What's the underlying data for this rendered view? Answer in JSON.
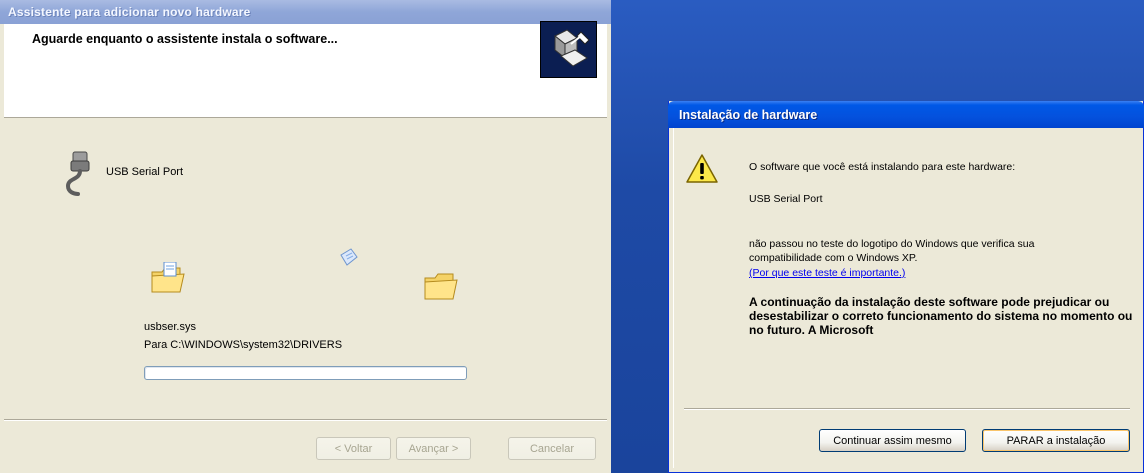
{
  "wizard": {
    "title": "Assistente para adicionar novo hardware",
    "heading": "Aguarde enquanto o assistente instala o software...",
    "device_name": "USB Serial Port",
    "file_name": "usbser.sys",
    "file_destination": "Para C:\\WINDOWS\\system32\\DRIVERS",
    "progress_fraction": 0,
    "buttons": {
      "back": "< Voltar",
      "next": "Avançar >",
      "cancel": "Cancelar"
    },
    "icons": [
      "hardware-wizard-logo-icon",
      "usb-plug-icon",
      "folder-icon",
      "document-icon"
    ]
  },
  "hw_dialog": {
    "title": "Instalação de hardware",
    "line1": "O software que você está instalando para este hardware:",
    "device_name": "USB Serial Port",
    "msg_line1": "não passou no teste do logotipo do Windows que verifica sua",
    "msg_line2": "compatibilidade com o Windows XP.",
    "link_text": "(Por que este teste é importante.)",
    "warning_text": "A continuação da instalação deste software pode prejudicar ou desestabilizar o correto funcionamento do sistema no momento ou no futuro. A Microsoft",
    "buttons": {
      "continue": "Continuar assim mesmo",
      "stop": "PARAR a instalação"
    },
    "icons": [
      "warning-icon"
    ]
  },
  "colors": {
    "desktop": "#1f4fa8",
    "dialog_face": "#ece9d8",
    "titlebar_active": "#0058e6",
    "titlebar_inactive": "#8fa6d8",
    "link": "#0000ee"
  }
}
